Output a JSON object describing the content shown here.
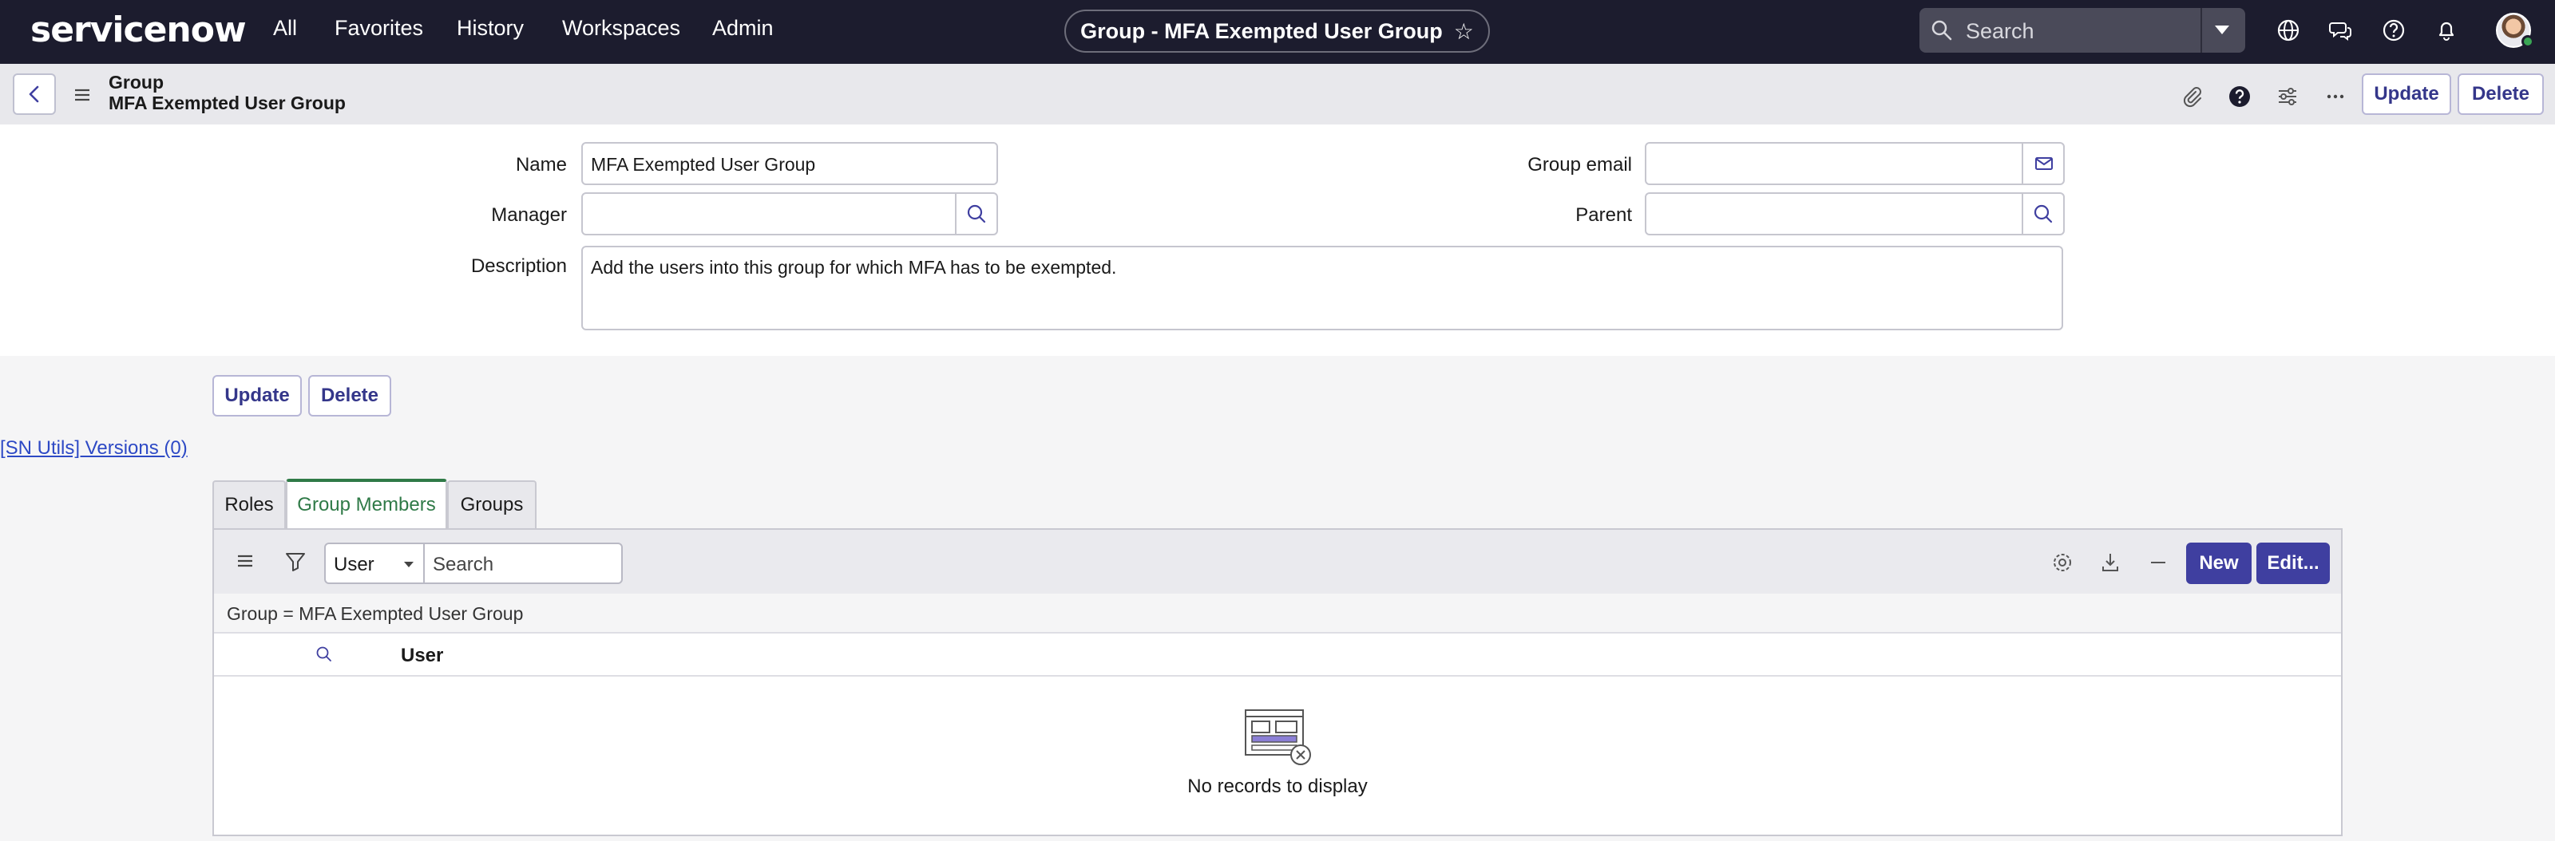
{
  "app": {
    "logo": "servicenow",
    "nav": [
      "All",
      "Favorites",
      "History",
      "Workspaces",
      "Admin"
    ],
    "title_pill": "Group - MFA Exempted User Group",
    "search_placeholder": "Search"
  },
  "header": {
    "title_line1": "Group",
    "title_line2": "MFA Exempted User Group",
    "update_label": "Update",
    "delete_label": "Delete"
  },
  "form": {
    "name_label": "Name",
    "name_value": "MFA Exempted User Group",
    "manager_label": "Manager",
    "manager_value": "",
    "description_label": "Description",
    "description_value": "Add the users into this group for which MFA has to be exempted.",
    "group_email_label": "Group email",
    "group_email_value": "",
    "parent_label": "Parent",
    "parent_value": ""
  },
  "footer_buttons": {
    "update_label": "Update",
    "delete_label": "Delete"
  },
  "sn_utils_link": "[SN Utils] Versions (0)",
  "tabs": [
    {
      "label": "Roles",
      "active": false
    },
    {
      "label": "Group Members",
      "active": true
    },
    {
      "label": "Groups",
      "active": false
    }
  ],
  "related_list": {
    "filter_field": "User",
    "search_placeholder": "Search",
    "new_label": "New",
    "edit_label": "Edit...",
    "condition": "Group = MFA Exempted User Group",
    "columns": [
      "User"
    ],
    "empty_message": "No records to display"
  },
  "colors": {
    "nav_bg": "#1c1c2e",
    "accent": "#3f3fa0",
    "active_tab": "#2f7a47",
    "link": "#2d49c5"
  }
}
